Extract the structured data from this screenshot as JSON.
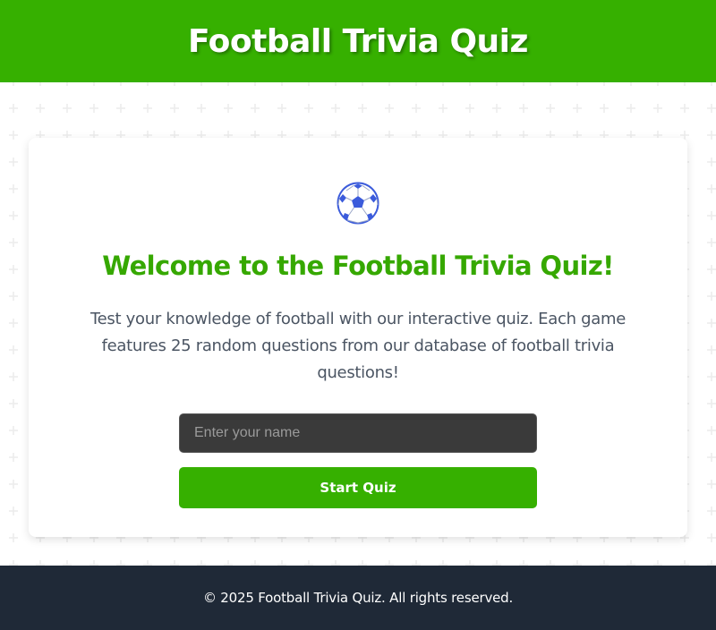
{
  "header": {
    "title": "Football Trivia Quiz"
  },
  "card": {
    "icon": "soccer-ball-icon",
    "welcome_title": "Welcome to the Football Trivia Quiz!",
    "description": "Test your knowledge of football with our interactive quiz. Each game features 25 random questions from our database of football trivia questions!",
    "name_input": {
      "placeholder": "Enter your name",
      "value": ""
    },
    "start_button_label": "Start Quiz"
  },
  "footer": {
    "copyright": "© 2025 Football Trivia Quiz. All rights reserved."
  },
  "colors": {
    "brand_green": "#36b000",
    "heading_green": "#36a800",
    "footer_bg": "#1f2937",
    "input_bg": "#3a3a3a",
    "ball_blue": "#3b5bdb"
  }
}
